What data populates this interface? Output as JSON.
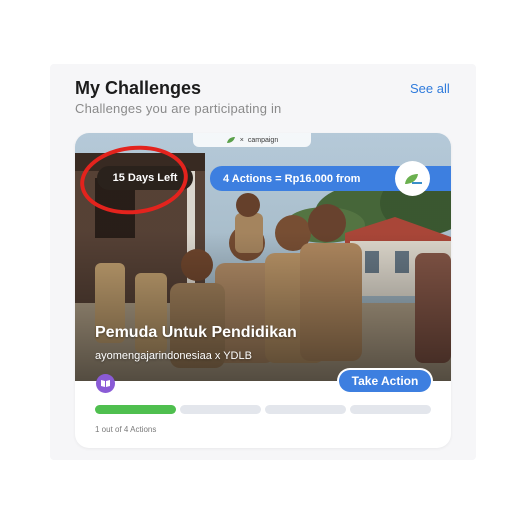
{
  "header": {
    "title": "My Challenges",
    "subtitle": "Challenges you are participating in",
    "see_all": "See all"
  },
  "card": {
    "days_left": "15 Days Left",
    "action_reward": "4 Actions = Rp16.000 from",
    "top_strip": {
      "separator": "×",
      "partner": "campaign"
    },
    "campaign_title": "Pemuda Untuk Pendidikan",
    "campaign_owner": "ayomengajarindonesiaa x YDLB",
    "take_action": "Take Action",
    "progress": {
      "completed": 1,
      "total": 4,
      "label": "1 out of 4 Actions"
    },
    "icons": {
      "badge": "book-icon",
      "partner": "leaf-logo-icon",
      "highlight": "red-circle-annotation"
    }
  },
  "colors": {
    "accent": "#3d7fe0",
    "link": "#2f7bdc",
    "progress_done": "#4fbf4f",
    "progress_todo": "#e3e6ec",
    "annotation": "#e3231d",
    "badge": "#8a5bd6"
  }
}
